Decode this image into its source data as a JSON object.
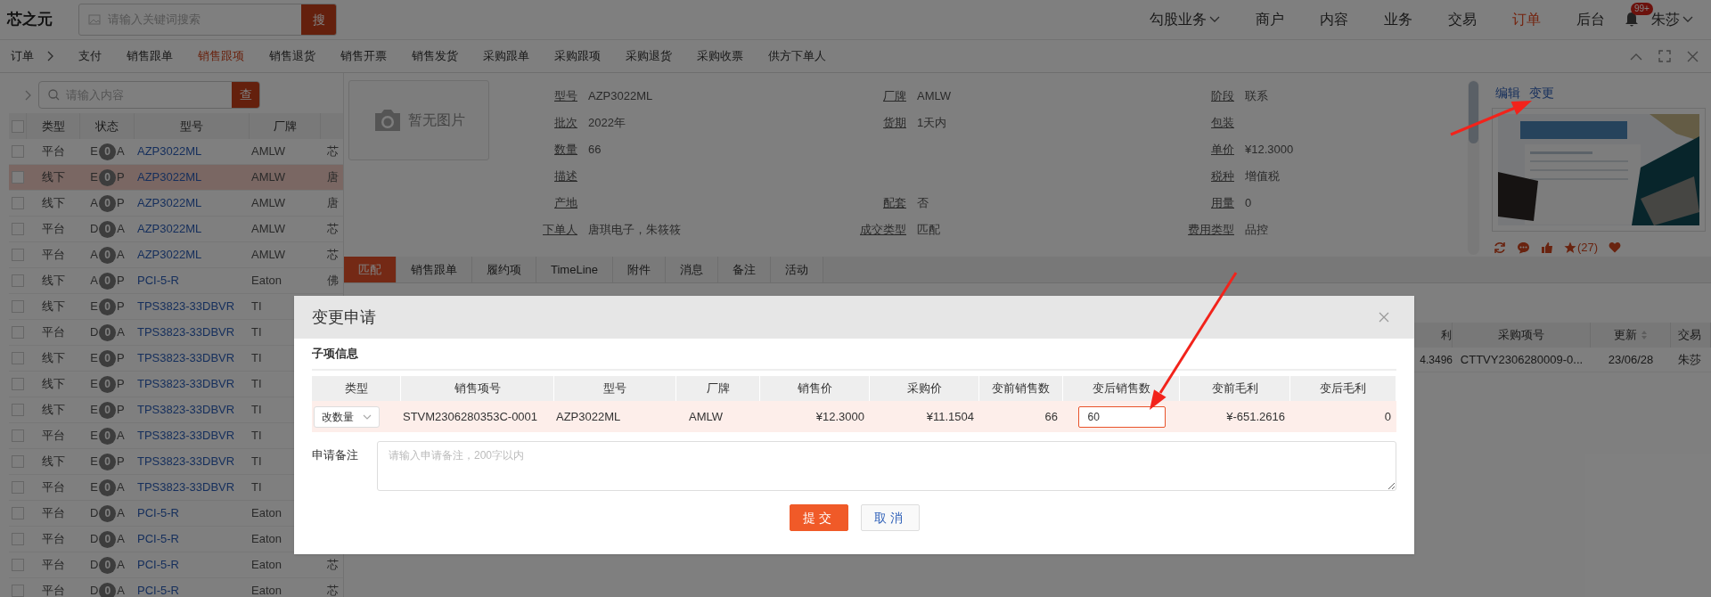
{
  "top_bar": {
    "logo": "芯之元",
    "search": {
      "placeholder": "请输入关键词搜索",
      "button": "搜"
    },
    "nav": [
      {
        "label": "勾股业务",
        "dropdown": true,
        "selected": false
      },
      {
        "label": "商户",
        "dropdown": false,
        "selected": false
      },
      {
        "label": "内容",
        "dropdown": false,
        "selected": false
      },
      {
        "label": "业务",
        "dropdown": false,
        "selected": false
      },
      {
        "label": "交易",
        "dropdown": false,
        "selected": false
      },
      {
        "label": "订单",
        "dropdown": false,
        "selected": true
      },
      {
        "label": "后台",
        "dropdown": false,
        "selected": false
      }
    ],
    "notification_badge": "99+",
    "user": "朱莎"
  },
  "sub_nav": {
    "breadcrumb": "订单",
    "tabs": [
      {
        "label": "支付",
        "selected": false
      },
      {
        "label": "销售跟单",
        "selected": false
      },
      {
        "label": "销售跟项",
        "selected": true
      },
      {
        "label": "销售退货",
        "selected": false
      },
      {
        "label": "销售开票",
        "selected": false
      },
      {
        "label": "销售发货",
        "selected": false
      },
      {
        "label": "采购跟单",
        "selected": false
      },
      {
        "label": "采购跟项",
        "selected": false
      },
      {
        "label": "采购退货",
        "selected": false
      },
      {
        "label": "采购收票",
        "selected": false
      },
      {
        "label": "供方下单人",
        "selected": false
      }
    ]
  },
  "list_panel": {
    "search": {
      "placeholder": "请输入内容",
      "button": "查"
    },
    "all_checked": false,
    "columns": [
      "类型",
      "状态",
      "型号",
      "厂牌"
    ],
    "rows": [
      {
        "checked": false,
        "selected": false,
        "type": "平台",
        "status": [
          "E",
          "0",
          "A"
        ],
        "model": "AZP3022ML",
        "brand": "AMLW",
        "column_5": "芯"
      },
      {
        "checked": false,
        "selected": true,
        "type": "线下",
        "status": [
          "E",
          "0",
          "P"
        ],
        "model": "AZP3022ML",
        "brand": "AMLW",
        "column_5": "唐"
      },
      {
        "checked": false,
        "selected": false,
        "type": "线下",
        "status": [
          "A",
          "0",
          "P"
        ],
        "model": "AZP3022ML",
        "brand": "AMLW",
        "column_5": "唐"
      },
      {
        "checked": false,
        "selected": false,
        "type": "平台",
        "status": [
          "D",
          "0",
          "A"
        ],
        "model": "AZP3022ML",
        "brand": "AMLW",
        "column_5": "芯"
      },
      {
        "checked": false,
        "selected": false,
        "type": "平台",
        "status": [
          "A",
          "0",
          "A"
        ],
        "model": "AZP3022ML",
        "brand": "AMLW",
        "column_5": "芯"
      },
      {
        "checked": false,
        "selected": false,
        "type": "线下",
        "status": [
          "A",
          "0",
          "P"
        ],
        "model": "PCI-5-R",
        "brand": "Eaton",
        "column_5": "佛"
      },
      {
        "checked": false,
        "selected": false,
        "type": "线下",
        "status": [
          "E",
          "0",
          "P"
        ],
        "model": "TPS3823-33DBVR",
        "brand": "TI"
      },
      {
        "checked": false,
        "selected": false,
        "type": "平台",
        "status": [
          "D",
          "0",
          "A"
        ],
        "model": "TPS3823-33DBVR",
        "brand": "TI"
      },
      {
        "checked": false,
        "selected": false,
        "type": "线下",
        "status": [
          "E",
          "0",
          "P"
        ],
        "model": "TPS3823-33DBVR",
        "brand": "TI"
      },
      {
        "checked": false,
        "selected": false,
        "type": "线下",
        "status": [
          "E",
          "0",
          "P"
        ],
        "model": "TPS3823-33DBVR",
        "brand": "TI"
      },
      {
        "checked": false,
        "selected": false,
        "type": "线下",
        "status": [
          "E",
          "0",
          "P"
        ],
        "model": "TPS3823-33DBVR",
        "brand": "TI"
      },
      {
        "checked": false,
        "selected": false,
        "type": "平台",
        "status": [
          "E",
          "0",
          "A"
        ],
        "model": "TPS3823-33DBVR",
        "brand": "TI"
      },
      {
        "checked": false,
        "selected": false,
        "type": "线下",
        "status": [
          "E",
          "0",
          "P"
        ],
        "model": "TPS3823-33DBVR",
        "brand": "TI"
      },
      {
        "checked": false,
        "selected": false,
        "type": "平台",
        "status": [
          "E",
          "0",
          "A"
        ],
        "model": "TPS3823-33DBVR",
        "brand": "TI"
      },
      {
        "checked": false,
        "selected": false,
        "type": "平台",
        "status": [
          "D",
          "0",
          "A"
        ],
        "model": "PCI-5-R",
        "brand": "Eaton"
      },
      {
        "checked": false,
        "selected": false,
        "type": "平台",
        "status": [
          "D",
          "0",
          "A"
        ],
        "model": "PCI-5-R",
        "brand": "Eaton"
      },
      {
        "checked": false,
        "selected": false,
        "type": "平台",
        "status": [
          "D",
          "0",
          "A"
        ],
        "model": "PCI-5-R",
        "brand": "Eaton",
        "column_5": "芯"
      },
      {
        "checked": false,
        "selected": false,
        "type": "平台",
        "status": [
          "D",
          "0",
          "A"
        ],
        "model": "PCI-5-R",
        "brand": "Eaton",
        "column_5": "芯"
      }
    ]
  },
  "detail": {
    "image_placeholder": "暂无图片",
    "rows": [
      [
        {
          "label": "型号",
          "value": "AZP3022ML"
        },
        {
          "label": "厂牌",
          "value": "AMLW"
        },
        {
          "label": "阶段",
          "value": "联系"
        }
      ],
      [
        {
          "label": "批次",
          "value": "2022年"
        },
        {
          "label": "货期",
          "value": "1天内"
        },
        {
          "label": "包装"
        }
      ],
      [
        {
          "label": "数量",
          "value": "66"
        },
        null,
        {
          "label": "单价",
          "value": "¥12.3000"
        }
      ],
      [
        {
          "label": "描述"
        },
        null,
        {
          "label": "税种",
          "value": "增值税"
        }
      ],
      [
        {
          "label": "产地"
        },
        {
          "label": "配套",
          "value": "否"
        },
        {
          "label": "用量",
          "value": "0"
        }
      ],
      [
        {
          "label": "下单人",
          "value": "唐琪电子，朱筱筱"
        },
        {
          "label": "成交类型",
          "value": "匹配"
        },
        {
          "label": "费用类型",
          "value": "品控"
        }
      ]
    ],
    "actions": [
      "编辑",
      "变更"
    ],
    "star_count": "(27)"
  },
  "detail_tabs": [
    {
      "label": "匹配",
      "selected": true
    },
    {
      "label": "销售跟单",
      "selected": false
    },
    {
      "label": "履约项",
      "selected": false
    },
    {
      "label": "TimeLine",
      "selected": false
    },
    {
      "label": "附件",
      "selected": false
    },
    {
      "label": "消息",
      "selected": false
    },
    {
      "label": "备注",
      "selected": false
    },
    {
      "label": "活动",
      "selected": false
    }
  ],
  "background_table": {
    "columns": [
      "利",
      "采购项号",
      "更新",
      "交易"
    ],
    "row": [
      "4.3496",
      "CTTVY2306280009-0...",
      "23/06/28",
      "朱莎"
    ]
  },
  "dialog": {
    "title": "变更申请",
    "section": "子项信息",
    "columns": [
      "类型",
      "销售项号",
      "型号",
      "厂牌",
      "销售价",
      "采购价",
      "变前销售数",
      "变后销售数",
      "变前毛利",
      "变后毛利"
    ],
    "row": [
      {
        "kind": "select",
        "value": "改数量"
      },
      {
        "kind": "text",
        "value": "STVM2306280353C-0001"
      },
      {
        "kind": "text",
        "value": "AZP3022ML"
      },
      {
        "kind": "text",
        "value": "AMLW"
      },
      {
        "kind": "number",
        "value": "¥12.3000"
      },
      {
        "kind": "number",
        "value": "¥11.1504"
      },
      {
        "kind": "number",
        "value": "66"
      },
      {
        "kind": "input",
        "value": "60"
      },
      {
        "kind": "number",
        "value": "¥-651.2616"
      },
      {
        "kind": "number",
        "value": "0"
      }
    ],
    "remark": {
      "label": "申请备注",
      "placeholder": "请输入申请备注，200字以内"
    },
    "buttons": [
      {
        "label": "提交",
        "kind": "primary"
      },
      {
        "label": "取消",
        "kind": "secondary"
      }
    ]
  }
}
